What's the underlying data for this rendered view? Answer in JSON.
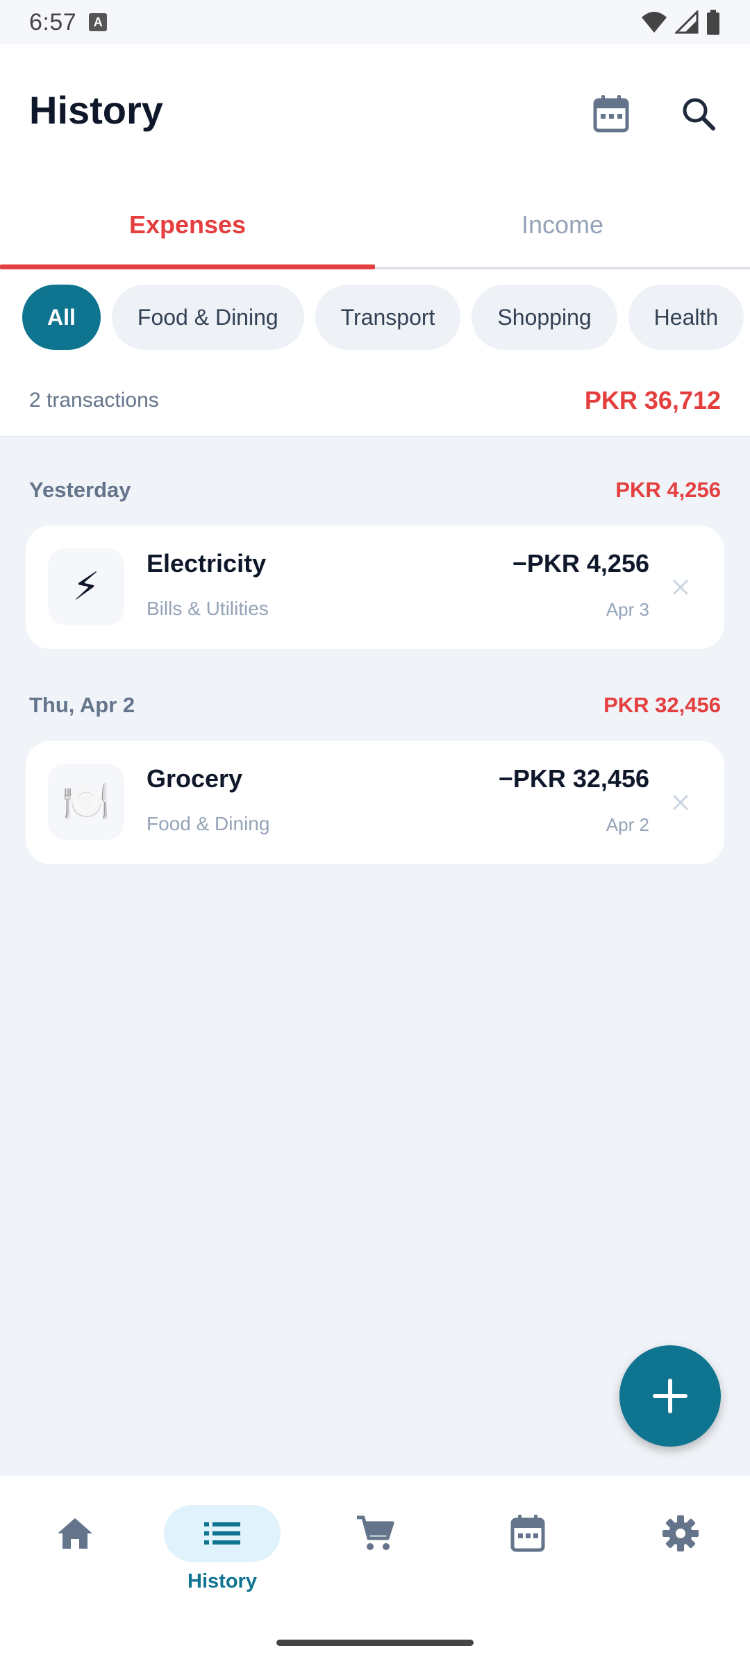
{
  "status_bar": {
    "time": "6:57",
    "notification_letter": "A"
  },
  "header": {
    "title": "History"
  },
  "tabs": [
    {
      "label": "Expenses",
      "active": true
    },
    {
      "label": "Income",
      "active": false
    }
  ],
  "filters": [
    {
      "label": "All",
      "active": true
    },
    {
      "label": "Food & Dining",
      "active": false
    },
    {
      "label": "Transport",
      "active": false
    },
    {
      "label": "Shopping",
      "active": false
    },
    {
      "label": "Health",
      "active": false
    }
  ],
  "summary": {
    "count": "2 transactions",
    "total": "PKR 36,712"
  },
  "groups": [
    {
      "label": "Yesterday",
      "total": "PKR 4,256",
      "items": [
        {
          "icon": "⚡",
          "icon_name": "lightning-icon",
          "title": "Electricity",
          "category": "Bills & Utilities",
          "amount": "−PKR 4,256",
          "date": "Apr 3"
        }
      ]
    },
    {
      "label": "Thu, Apr 2",
      "total": "PKR 32,456",
      "items": [
        {
          "icon": "🍽️",
          "icon_name": "plate-icon",
          "title": "Grocery",
          "category": "Food & Dining",
          "amount": "−PKR 32,456",
          "date": "Apr 2"
        }
      ]
    }
  ],
  "bottom_nav": [
    {
      "icon": "home-icon",
      "label": "",
      "active": false
    },
    {
      "icon": "list-icon",
      "label": "History",
      "active": true
    },
    {
      "icon": "cart-icon",
      "label": "",
      "active": false
    },
    {
      "icon": "calendar-icon",
      "label": "",
      "active": false
    },
    {
      "icon": "gear-icon",
      "label": "",
      "active": false
    }
  ],
  "colors": {
    "accent": "#0E7490",
    "expense": "#E53E3E",
    "background": "#F0F3F8",
    "muted": "#94A3B8"
  }
}
